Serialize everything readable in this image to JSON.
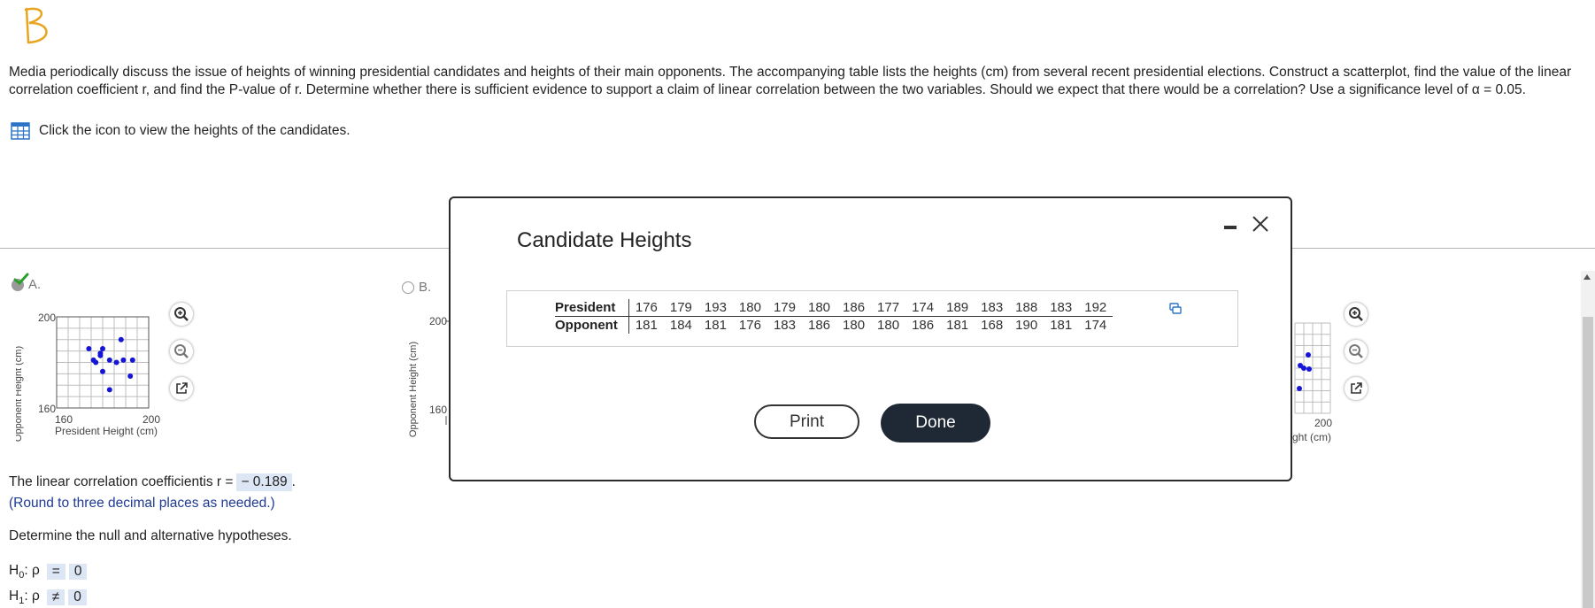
{
  "problem": {
    "text": "Media periodically discuss the issue of heights of winning presidential candidates and heights of their main opponents. The accompanying table lists the heights (cm) from several recent presidential elections. Construct a scatterplot, find the value of the linear correlation coefficient r, and find the P-value of r. Determine whether there is sufficient evidence to support a claim of linear correlation between the two variables. Should we expect that there would be a correlation? Use a significance level of α = 0.05.",
    "table_link_label": "Click the icon to view the heights of the candidates.",
    "handwritten_mark": "B"
  },
  "choices": {
    "a_label": "A.",
    "b_label": "B.",
    "selected": "A"
  },
  "plot_a": {
    "y_axis_label": "Opponent Height (cm)",
    "x_axis_label": "President Height (cm)",
    "y_tick_top": "200",
    "y_tick_bottom": "160",
    "x_tick_left": "160",
    "x_tick_right": "200"
  },
  "plot_b": {
    "y_axis_label": "Opponent Height (cm)",
    "y_tick_top": "200",
    "y_tick_bottom": "160"
  },
  "plot_d": {
    "x_tick_right": "200",
    "x_axis_label_partial": "ght (cm)"
  },
  "answers": {
    "r_prefix": "The linear correlation coefficientis r =",
    "r_value": "− 0.189",
    "r_suffix": ".",
    "round_hint": "(Round to three decimal places as needed.)",
    "hyp_prompt": "Determine the null and alternative hypotheses.",
    "h0_symbol": "=",
    "h0_value": "0",
    "h1_symbol": "≠",
    "h1_value": "0"
  },
  "modal": {
    "title": "Candidate Heights",
    "row_labels": [
      "President",
      "Opponent"
    ],
    "president": [
      "176",
      "179",
      "193",
      "180",
      "179",
      "180",
      "186",
      "177",
      "174",
      "189",
      "183",
      "188",
      "183",
      "192"
    ],
    "opponent": [
      "181",
      "184",
      "181",
      "176",
      "183",
      "186",
      "180",
      "180",
      "186",
      "181",
      "168",
      "190",
      "181",
      "174"
    ],
    "print_label": "Print",
    "done_label": "Done"
  },
  "colors": {
    "point": "#1515d8",
    "answer_bg": "#dde6f4",
    "done_bg": "#1f2835",
    "check": "#2aa02a",
    "hint": "#1f3a93"
  }
}
